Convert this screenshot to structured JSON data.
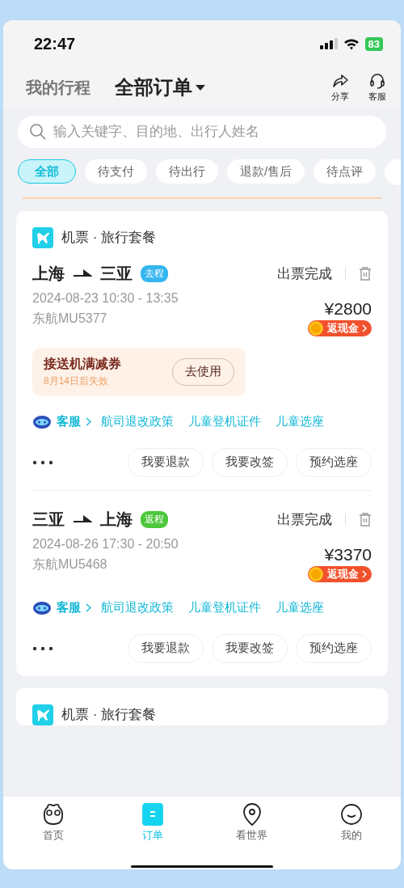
{
  "status_bar": {
    "time": "22:47",
    "battery": "83"
  },
  "header": {
    "tabs": [
      {
        "label": "我的行程",
        "selected": false
      },
      {
        "label": "全部订单",
        "selected": true
      }
    ],
    "actions": [
      {
        "label": "分享",
        "kind": "share"
      },
      {
        "label": "客服",
        "kind": "service"
      }
    ]
  },
  "search": {
    "placeholder": "输入关键字、目的地、出行人姓名"
  },
  "filters": [
    {
      "label": "全部",
      "selected": true
    },
    {
      "label": "待支付",
      "selected": false
    },
    {
      "label": "待出行",
      "selected": false
    },
    {
      "label": "退款/售后",
      "selected": false
    },
    {
      "label": "待点评",
      "selected": false
    }
  ],
  "orders": [
    {
      "category": "机票 · 旅行套餐",
      "segments": [
        {
          "from": "上海",
          "to": "三亚",
          "direction": "去程",
          "color": "#35b6f0",
          "status": "出票完成",
          "time": "2024-08-23 10:30 - 13:35",
          "flight": "东航MU5377",
          "price": "¥2800",
          "cashback": "返现金",
          "coupon": {
            "title": "接送机满减券",
            "expiry": "8月14日后失效",
            "button": "去使用"
          },
          "service": "客服",
          "links": [
            "航司退改政策",
            "儿童登机证件",
            "儿童选座"
          ],
          "buttons": [
            "我要退款",
            "我要改签",
            "预约选座"
          ]
        },
        {
          "from": "三亚",
          "to": "上海",
          "direction": "返程",
          "color": "#4cc73a",
          "status": "出票完成",
          "time": "2024-08-26 17:30 - 20:50",
          "flight": "东航MU5468",
          "price": "¥3370",
          "cashback": "返现金",
          "service": "客服",
          "links": [
            "航司退改政策",
            "儿童登机证件",
            "儿童选座"
          ],
          "buttons": [
            "我要退款",
            "我要改签",
            "预约选座"
          ]
        }
      ]
    },
    {
      "category": "机票 · 旅行套餐"
    }
  ],
  "nav": [
    {
      "label": "首页",
      "kind": "home",
      "selected": false
    },
    {
      "label": "订单",
      "kind": "orders",
      "selected": true
    },
    {
      "label": "看世界",
      "kind": "explore",
      "selected": false
    },
    {
      "label": "我的",
      "kind": "profile",
      "selected": false
    }
  ]
}
